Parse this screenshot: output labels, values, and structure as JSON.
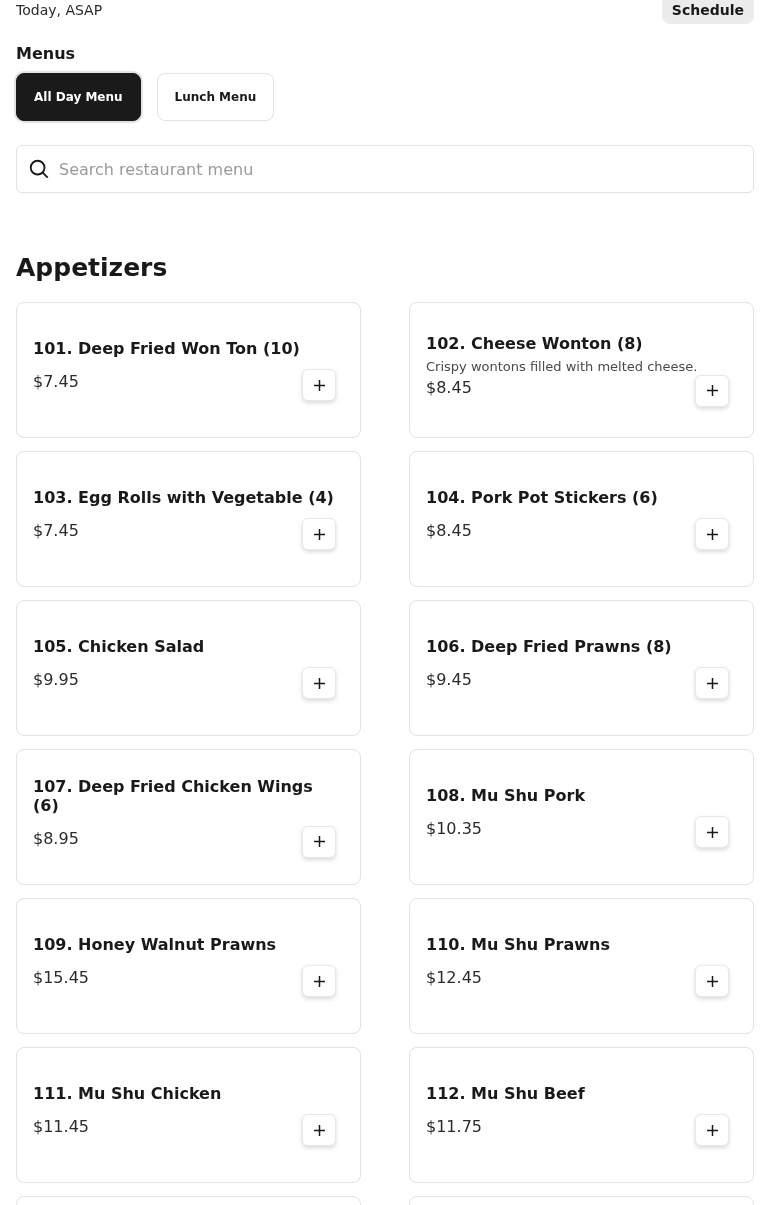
{
  "delivery_time": "Today, ASAP",
  "schedule_button": "Schedule",
  "menus": {
    "title": "Menus",
    "tabs": [
      {
        "label": "All Day Menu",
        "selected": true
      },
      {
        "label": "Lunch Menu",
        "selected": false
      }
    ]
  },
  "search": {
    "placeholder": "Search restaurant menu"
  },
  "section": {
    "title": "Appetizers",
    "items": [
      {
        "name": "101. Deep Fried Won Ton (10)",
        "price": "$7.45"
      },
      {
        "name": "102. Cheese Wonton (8)",
        "description": "Crispy wontons filled with melted cheese.",
        "price": "$8.45"
      },
      {
        "name": "103. Egg Rolls with Vegetable (4)",
        "price": "$7.45"
      },
      {
        "name": "104. Pork Pot Stickers (6)",
        "price": "$8.45"
      },
      {
        "name": "105. Chicken Salad",
        "price": "$9.95"
      },
      {
        "name": "106. Deep Fried Prawns (8)",
        "price": "$9.45"
      },
      {
        "name": "107. Deep Fried Chicken Wings (6)",
        "price": "$8.95"
      },
      {
        "name": "108. Mu Shu Pork",
        "price": "$10.35"
      },
      {
        "name": "109. Honey Walnut Prawns",
        "price": "$15.45"
      },
      {
        "name": "110. Mu Shu Prawns",
        "price": "$12.45"
      },
      {
        "name": "111. Mu Shu Chicken",
        "price": "$11.45"
      },
      {
        "name": "112. Mu Shu Beef",
        "price": "$11.75"
      }
    ]
  }
}
